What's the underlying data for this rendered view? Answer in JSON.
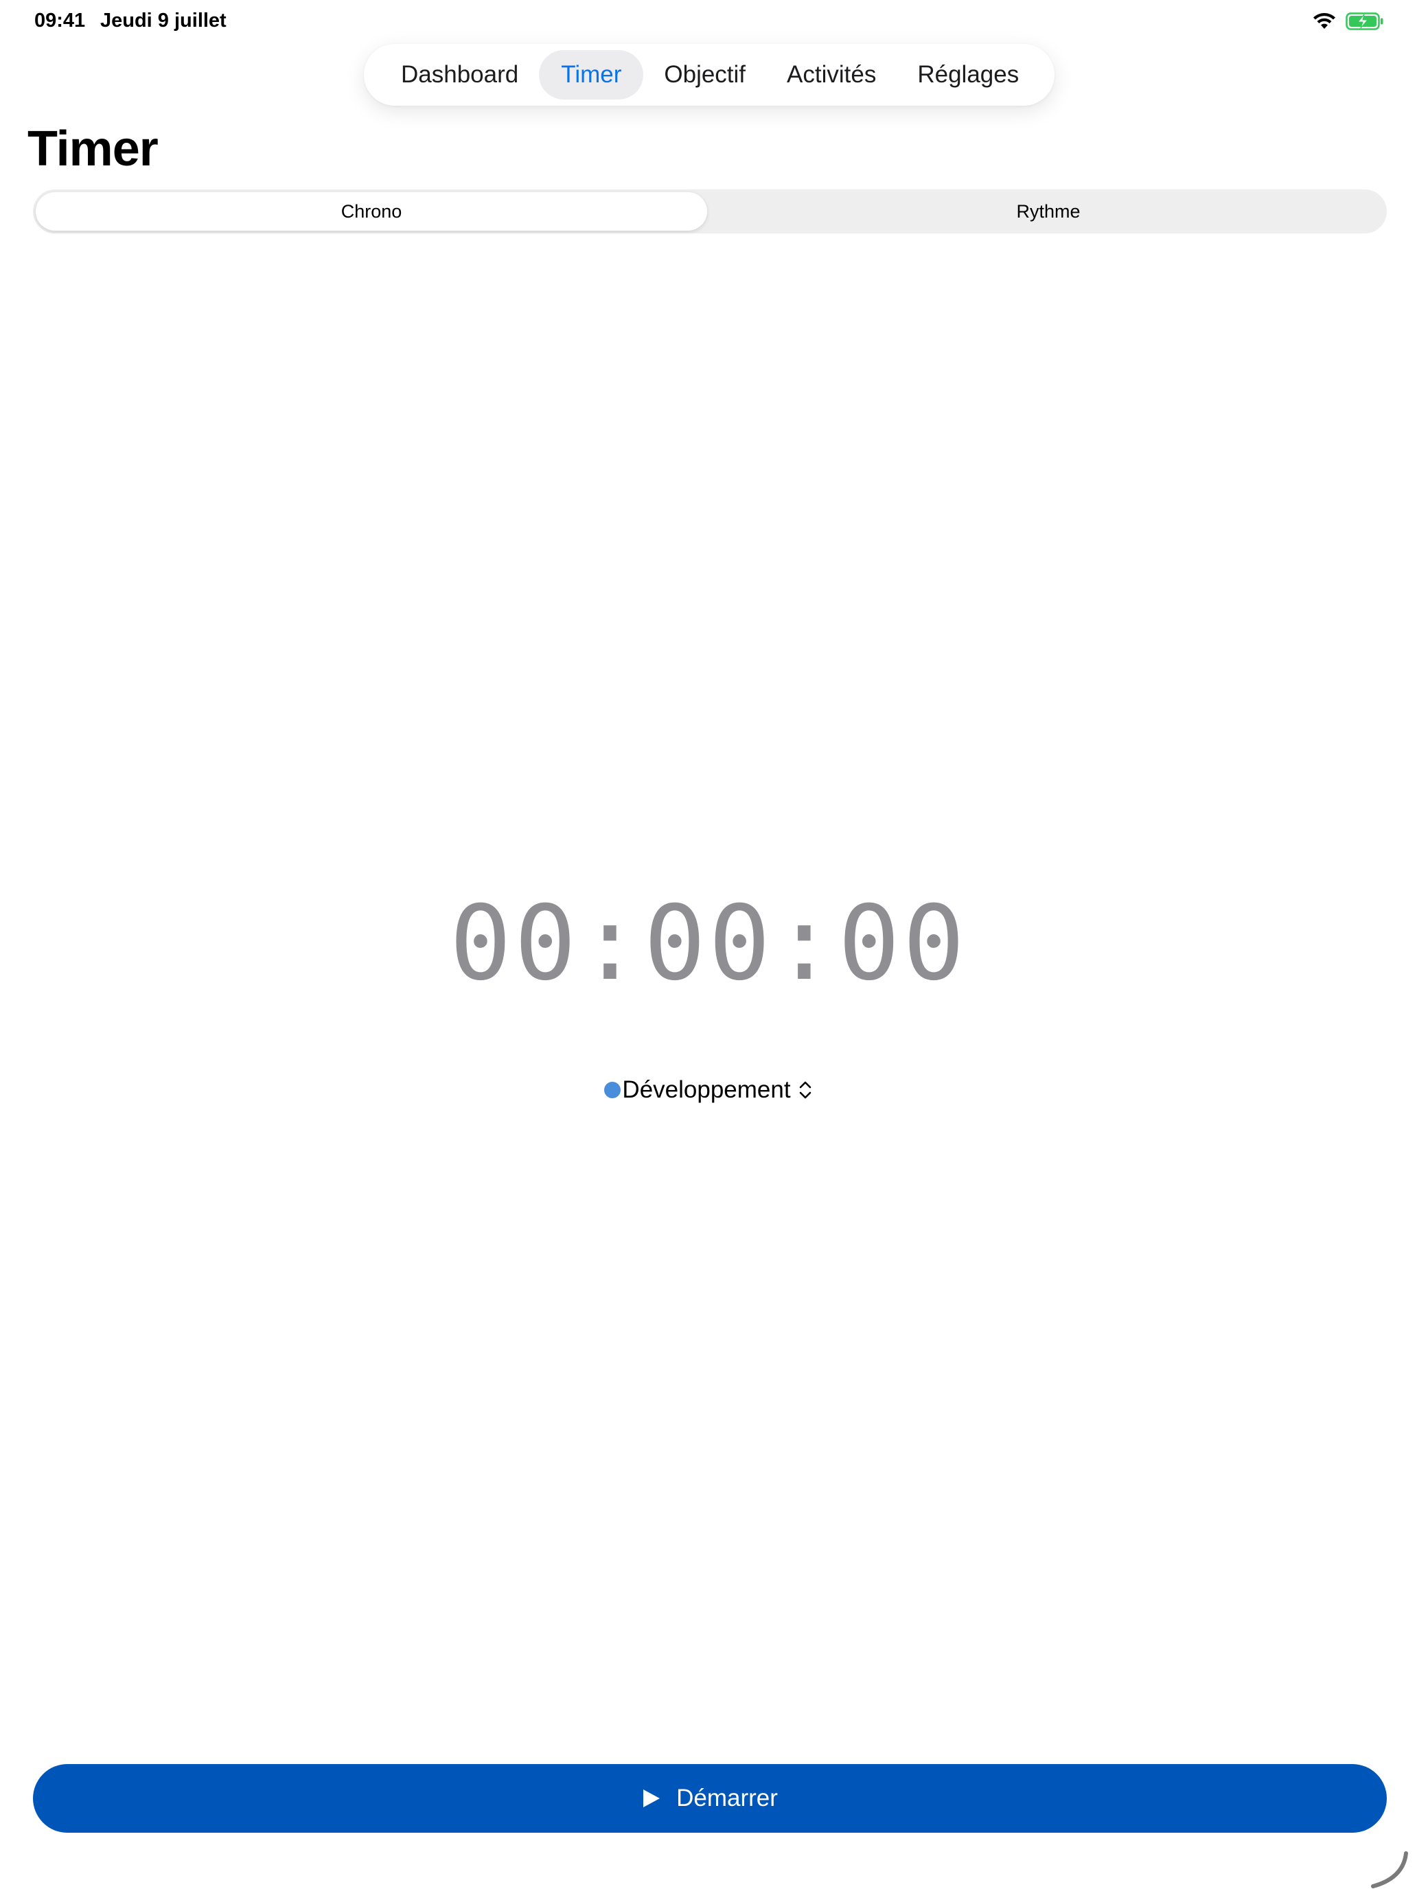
{
  "status_bar": {
    "time": "09:41",
    "date": "Jeudi 9 juillet",
    "wifi_icon": "wifi-icon",
    "battery_icon": "battery-charging-icon",
    "battery_color": "#34c759"
  },
  "tabbar": {
    "tabs": [
      {
        "label": "Dashboard",
        "active": false
      },
      {
        "label": "Timer",
        "active": true
      },
      {
        "label": "Objectif",
        "active": false
      },
      {
        "label": "Activités",
        "active": false
      },
      {
        "label": "Réglages",
        "active": false
      }
    ],
    "active_color": "#0a74e4"
  },
  "page": {
    "title": "Timer"
  },
  "segmented": {
    "options": [
      "Chrono",
      "Rythme"
    ],
    "selected": "Chrono"
  },
  "timer": {
    "display": "00:00:00"
  },
  "activity": {
    "name": "Développement",
    "color": "#4a8ddb",
    "icon": "chevron-up-down-icon"
  },
  "start_button": {
    "label": "Démarrer",
    "icon": "play-icon",
    "color": "#0056b8"
  }
}
